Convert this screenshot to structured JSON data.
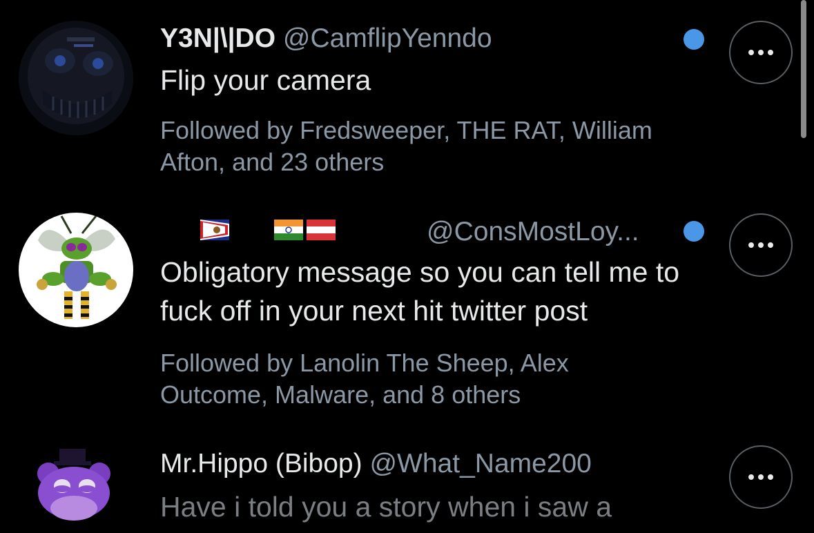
{
  "users": [
    {
      "display_name": "Y3N|\\|DO",
      "handle": "@CamflipYenndo",
      "bio": "Flip your camera",
      "followed_by": "Followed by Fredsweeper, THE RAT, William Afton, and 23 others",
      "avatar_icon": "dark-animatronic-avatar"
    },
    {
      "display_name": "",
      "flags": [
        "american-samoa-flag",
        "india-flag",
        "austria-flag"
      ],
      "handle": "@ConsMostLoy...",
      "bio": "Obligatory message so you can tell me to fuck off in your next hit twitter post",
      "followed_by": "Followed by Lanolin The Sheep, Alex Outcome, Malware, and 8 others",
      "avatar_icon": "wasp-robot-avatar"
    },
    {
      "display_name": "Mr.Hippo (Bibop)",
      "handle": "@What_Name200",
      "bio": "Have i told you a story when i saw a",
      "avatar_icon": "purple-hippo-avatar"
    }
  ],
  "colors": {
    "background": "#000000",
    "verified_dot": "#4a97e8",
    "secondary_text": "#8b98a5"
  }
}
